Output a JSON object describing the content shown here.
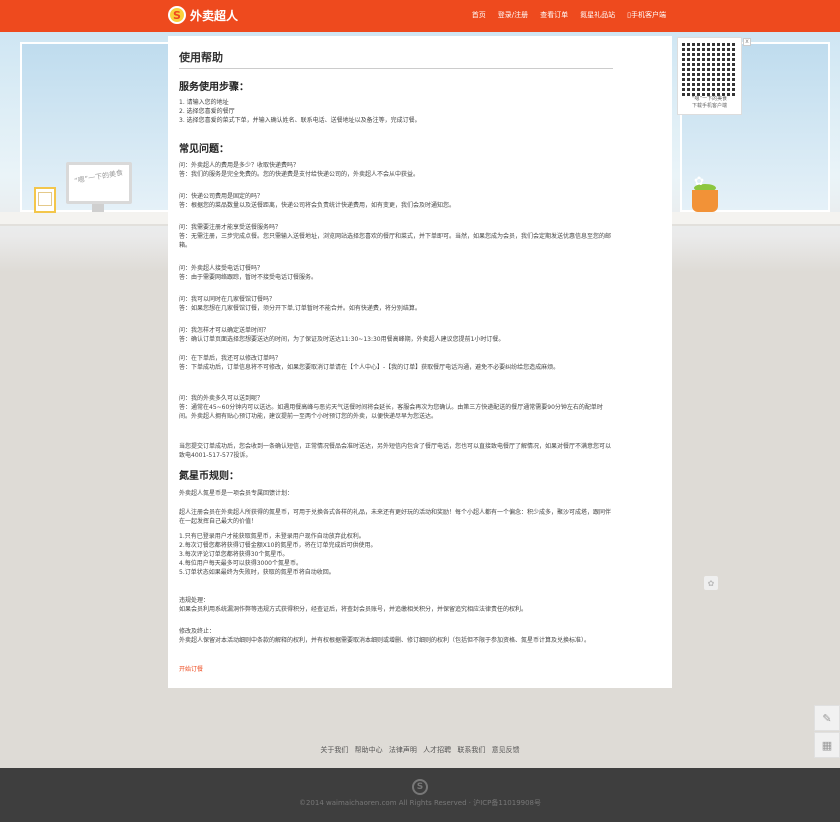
{
  "header": {
    "logo_mark": "S",
    "logo_text": "外卖超人",
    "nav": [
      "首页",
      "登录/注册",
      "查看订单",
      "氮星礼品站",
      "▯手机客户端"
    ]
  },
  "decor": {
    "monitor_text": "“嗯”一下的美食"
  },
  "qr": {
    "close": "x",
    "caption": "“嗯”一下的美食\n下载手机客户端"
  },
  "main": {
    "title": "使用帮助",
    "steps_heading": "服务使用步骤：",
    "steps": "1. 请输入您的地址\n2. 选择您喜爱的餐厅\n3. 选择您喜爱的菜式下单，并输入确认姓名、联系电话、送餐地址以及备注等，完成订餐。",
    "faq_heading": "常见问题：",
    "faq": [
      "问：外卖超人的费用是多少？收取快递费吗？\n答：我们的服务是完全免费的。您的快递费是支付给快递公司的，外卖超人不会从中获益。",
      "问：快递公司费用是固定的吗？\n答：根据您的菜品数量以及送餐距离，快递公司将会负责统计快递费用，如有变更，我们会及时通知您。",
      "问：我需要注册才能享受送餐服务吗？\n答：无需注册，三步完成点餐。您只需输入送餐地址，浏览网站选择您喜欢的餐厅和菜式，并下单即可。当然，如果您成为会员，我们会定期发送优惠信息至您的邮箱。",
      "问：外卖超人接受电话订餐吗？\n答：由于需要网络跟踪，暂时不接受电话订餐服务。",
      "问：我可以同时在几家餐馆订餐吗？\n答：如果您想在几家餐馆订餐，须分开下单,订单暂时不能合并。如有快递费，将分别结算。",
      "问：我怎样才可以确定送单时间？\n答：确认订单页面选择您想要送达的时间，为了保证及时送达11:30~13:30用餐高峰期，外卖超人建议您提前1小时订餐。",
      "问：在下单后，我还可以修改订单吗？\n答：下单成功后，订单信息将不可修改，如果您要取消订单请在【个人中心】-【我的订单】获取餐厅电话沟通，避免不必要纠纷给您造成麻烦。",
      "问：我的外卖多久可以送到呢？\n答：通常在45~60分钟内可以送达。如遇用餐高峰与恶劣天气送餐时间将会延长，客服会再次为您确认。由第三方快递配送的餐厅通常需要90分钟左右的配单时间。外卖超人拥有贴心预订功能，建议提前一至两个小时预订您的外卖，以便快递尽早为您送达。"
    ],
    "notice": "当您提交订单成功后，您会收到一条确认短信，正常情况餐品会准时送达，另外短信内包含了餐厅电话，您也可以直接致电餐厅了解情况，如果对餐厅不满意您可以致电4001-517-577投诉。",
    "rules_heading": "氮星币规则：",
    "rules_intro": "外卖超人氮星币是一项会员专属回馈计划：",
    "rules_desc": "超人注册会员在外卖超人所获得的氮星币，可用于兑换各式各样的礼品，未来还有更好玩的活动和奖励！每个小超人都有一个偏念：积少成多，聚沙可成塔，跟同伴在一起发挥自己最大的价值！",
    "rules_list": "1.只有已登录用户才能获取氮星币，未登录用户现作自动放弃此权利。\n2.每次订餐您都将获得订餐金额X10的氮星币，将在订单完成后可供使用。\n3.每次评论订单您都将获得30个氮星币。\n4.每位用户每天最多可以获得3000个氮星币。\n5.订单状态如果最终为失败时，获取的氮星币将自动收回。",
    "violation": "违规处理：\n如果会员利用系统漏洞作弊等违规方式获得积分，经查证后，将查封会员账号，并追缴相关积分，并保留追究相应法律责任的权利。",
    "termination": "修改及终止：\n外卖超人保留对本活动细则中条款的解释的权利，并有权根据需要取消本细则或增删、修订细则的权利（包括但不限于参加资格、氮星币计算及兑换标准）。",
    "start_link": "开始订餐"
  },
  "side_tools": {
    "edit_icon_glyph": "✎",
    "qr_icon_glyph": "▦",
    "float_glyph": "✿"
  },
  "footer": {
    "links": [
      "关于我们",
      "帮助中心",
      "法律声明",
      "人才招聘",
      "联系我们",
      "意见反馈"
    ],
    "mark": "S",
    "copyright": "©2014 waimaichaoren.com All Rights Reserved · 沪ICP备11019908号"
  }
}
